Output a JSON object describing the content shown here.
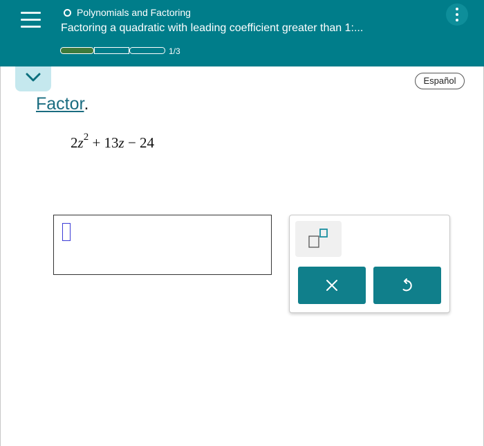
{
  "header": {
    "topic": "Polynomials and Factoring",
    "subtitle": "Factoring a quadratic with leading coefficient greater than 1:...",
    "progress": {
      "label": "1/3",
      "completed_segments": 1,
      "total_segments": 3
    }
  },
  "language_button": "Español",
  "question": {
    "instruction_link": "Factor",
    "instruction_end": ".",
    "expression": {
      "coef": "2",
      "var": "z",
      "exponent": "2",
      "rest_1": " + 13",
      "var2": "z",
      "rest_2": " − 24"
    }
  },
  "answer": {
    "value": ""
  },
  "colors": {
    "header_bg": "#007d8a",
    "progress_fill": "#3e7a3b",
    "key_bg": "#107f8b",
    "caret": "#3b3bd6"
  },
  "icons": {
    "menu": "hamburger-icon",
    "topic_status": "circle-icon",
    "more": "kebab-icon",
    "collapse": "chevron-down-icon",
    "exponent": "exponent-box-icon",
    "clear": "close-icon",
    "undo": "undo-icon"
  }
}
